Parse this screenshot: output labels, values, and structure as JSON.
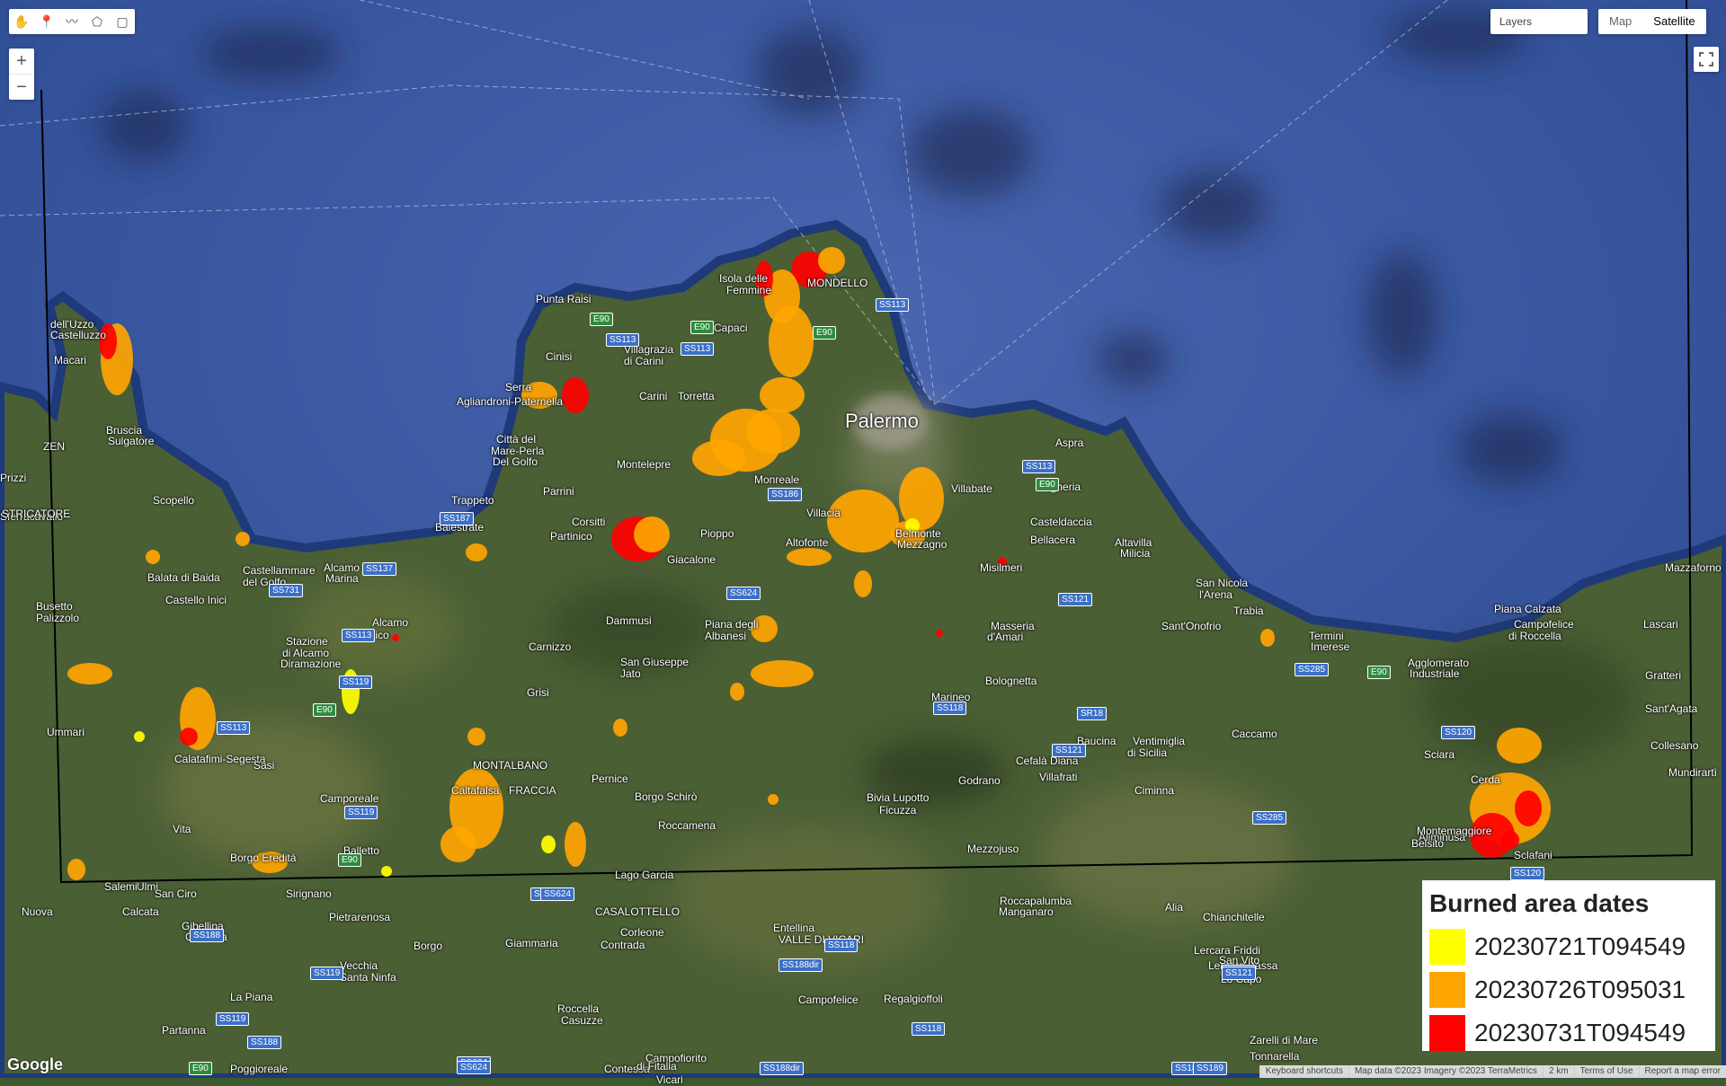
{
  "map": {
    "type": "satellite",
    "sea_color": "#2f4f9a",
    "land_color": "#4a5e33"
  },
  "toolbar": {
    "tools": [
      "pan-hand-icon",
      "marker-icon",
      "line-icon",
      "polygon-icon",
      "rectangle-icon"
    ]
  },
  "zoom": {
    "in": "+",
    "out": "−"
  },
  "layers": {
    "label": "Layers"
  },
  "maptype": {
    "map": "Map",
    "satellite": "Satellite"
  },
  "legend": {
    "title": "Burned area dates",
    "items": [
      {
        "label": "20230721T094549",
        "color": "#ffff00"
      },
      {
        "label": "20230726T095031",
        "color": "#ffa500"
      },
      {
        "label": "20230731T094549",
        "color": "#ff0000"
      }
    ]
  },
  "watermark": "© 2023 Google",
  "places": [
    {
      "name": "Palermo",
      "big": true
    },
    {
      "name": "MONDELLO"
    },
    {
      "name": "Isola delle"
    },
    {
      "name": "Femmine"
    },
    {
      "name": "Punta Raisi"
    },
    {
      "name": "Capaci"
    },
    {
      "name": "Villagrazia"
    },
    {
      "name": "di Carini"
    },
    {
      "name": "Carini"
    },
    {
      "name": "Torretta"
    },
    {
      "name": "Cinisi"
    },
    {
      "name": "Serra"
    },
    {
      "name": "Agliandroni-Paternella"
    },
    {
      "name": "Città del"
    },
    {
      "name": "Mare-Perla"
    },
    {
      "name": "Del Golfo"
    },
    {
      "name": "Montelepre"
    },
    {
      "name": "Trappeto"
    },
    {
      "name": "Parrini"
    },
    {
      "name": "Balestrate"
    },
    {
      "name": "Corsitti"
    },
    {
      "name": "Partinico"
    },
    {
      "name": "Pioppo"
    },
    {
      "name": "Giacalone"
    },
    {
      "name": "Altofonte"
    },
    {
      "name": "Villacia"
    },
    {
      "name": "Monreale"
    },
    {
      "name": "Belmonte"
    },
    {
      "name": "Mezzagno"
    },
    {
      "name": "Misilmeri"
    },
    {
      "name": "Villabate"
    },
    {
      "name": "Bagheria"
    },
    {
      "name": "Aspra"
    },
    {
      "name": "Casteldaccia"
    },
    {
      "name": "Bellacera"
    },
    {
      "name": "Altavilla"
    },
    {
      "name": "Milicia"
    },
    {
      "name": "San Nicola"
    },
    {
      "name": "l'Arena"
    },
    {
      "name": "Trabia"
    },
    {
      "name": "Sant'Onofrio"
    },
    {
      "name": "Termini"
    },
    {
      "name": "Imerese"
    },
    {
      "name": "Agglomerato"
    },
    {
      "name": "Industriale"
    },
    {
      "name": "Piana Calzata"
    },
    {
      "name": "Campofelice"
    },
    {
      "name": "di Roccella"
    },
    {
      "name": "Mazzaforno"
    },
    {
      "name": "Lascari"
    },
    {
      "name": "Gratteri"
    },
    {
      "name": "Sant'Agata"
    },
    {
      "name": "Collesano"
    },
    {
      "name": "Sciara"
    },
    {
      "name": "Cerda"
    },
    {
      "name": "Aliminusa"
    },
    {
      "name": "Montemaggiore"
    },
    {
      "name": "Belsito"
    },
    {
      "name": "Sclafani"
    },
    {
      "name": "Mundirartì"
    },
    {
      "name": "Caccamo"
    },
    {
      "name": "Baucina"
    },
    {
      "name": "Ventimiglia"
    },
    {
      "name": "di Sicilia"
    },
    {
      "name": "Ciminna"
    },
    {
      "name": "Cefalà Diana"
    },
    {
      "name": "Villafrati"
    },
    {
      "name": "Godrano"
    },
    {
      "name": "Marineo"
    },
    {
      "name": "Bolognetta"
    },
    {
      "name": "Masseria"
    },
    {
      "name": "d'Amari"
    },
    {
      "name": "Bivia Lupotto"
    },
    {
      "name": "Ficuzza"
    },
    {
      "name": "Mezzojuso"
    },
    {
      "name": "Piana degli"
    },
    {
      "name": "Albanesi"
    },
    {
      "name": "Dammusi"
    },
    {
      "name": "San Giuseppe"
    },
    {
      "name": "Jato"
    },
    {
      "name": "Carnizzo"
    },
    {
      "name": "Grisi"
    },
    {
      "name": "Fico"
    },
    {
      "name": "Alcamo"
    },
    {
      "name": "Alcamo"
    },
    {
      "name": "Marina"
    },
    {
      "name": "Castellammare"
    },
    {
      "name": "del Golfo"
    },
    {
      "name": "Scopello"
    },
    {
      "name": "Balata di Baida"
    },
    {
      "name": "Castello Inici"
    },
    {
      "name": "Busetto"
    },
    {
      "name": "Palizzolo"
    },
    {
      "name": "Stazione"
    },
    {
      "name": "di Alcamo"
    },
    {
      "name": "Diramazione"
    },
    {
      "name": "Calatafimi-Segesta"
    },
    {
      "name": "Sasi"
    },
    {
      "name": "Ummari"
    },
    {
      "name": "Vita"
    },
    {
      "name": "Borgo Ereditá"
    },
    {
      "name": "Ulmi"
    },
    {
      "name": "Salemi"
    },
    {
      "name": "San Ciro"
    },
    {
      "name": "Calcata"
    },
    {
      "name": "Nuova"
    },
    {
      "name": "Gibellina"
    },
    {
      "name": "Gibellina"
    },
    {
      "name": "Vecchia"
    },
    {
      "name": "Santa Ninfa"
    },
    {
      "name": "La Piana"
    },
    {
      "name": "Partanna"
    },
    {
      "name": "Poggioreale"
    },
    {
      "name": "Borgo"
    },
    {
      "name": "Roccella"
    },
    {
      "name": "Casuzze"
    },
    {
      "name": "Pietrarenosa"
    },
    {
      "name": "Sirignano"
    },
    {
      "name": "Camporeale"
    },
    {
      "name": "FRACCIA"
    },
    {
      "name": "MONTALBANO"
    },
    {
      "name": "Caltafalsa"
    },
    {
      "name": "Balletto"
    },
    {
      "name": "Pernice"
    },
    {
      "name": "Borgo Schirò"
    },
    {
      "name": "Roccamena"
    },
    {
      "name": "Lago Garcia"
    },
    {
      "name": "CASALOTTELLO"
    },
    {
      "name": "Contrada"
    },
    {
      "name": "Giammaria"
    },
    {
      "name": "Corleone"
    },
    {
      "name": "Campofiorito"
    },
    {
      "name": "Contessa"
    },
    {
      "name": "Entellina"
    },
    {
      "name": "VALLE DI VICARI"
    },
    {
      "name": "Campofelice"
    },
    {
      "name": "di Fitalia"
    },
    {
      "name": "Vicari"
    },
    {
      "name": "Regalgioffoli"
    },
    {
      "name": "Roccapalumba"
    },
    {
      "name": "Manganaro"
    },
    {
      "name": "Alia"
    },
    {
      "name": "Chianchitelle"
    },
    {
      "name": "Lercara Friddi"
    },
    {
      "name": "Lercara Bassa"
    },
    {
      "name": "San Vito"
    },
    {
      "name": "Lo Capo"
    },
    {
      "name": "Zarelli di Mare"
    },
    {
      "name": "Tonnarella"
    },
    {
      "name": "dell'Uzzo"
    },
    {
      "name": "Castelluzzo"
    },
    {
      "name": "Macari"
    },
    {
      "name": "Bruscia"
    },
    {
      "name": "Sulgatore"
    },
    {
      "name": "ZEN"
    },
    {
      "name": "Sferracavallo"
    },
    {
      "name": "Prizzi"
    },
    {
      "name": "STRICATORE"
    }
  ],
  "roads": [
    "E90",
    "SS113",
    "E90",
    "SS113",
    "E90",
    "SS113",
    "SS186",
    "SS624",
    "SS113",
    "SS187",
    "SS137",
    "SS731",
    "SS113",
    "SS119",
    "SS113",
    "E90",
    "SS119",
    "E90",
    "SS624",
    "SS118",
    "SS121",
    "SS121",
    "SR18",
    "E90",
    "SS285",
    "E90",
    "SS120",
    "SS285",
    "SS120",
    "SS121",
    "SS624",
    "SS188",
    "SS119",
    "SS119",
    "SS188",
    "SS624",
    "SS118",
    "SS188dir",
    "SS118",
    "SS121",
    "SS188",
    "SS189",
    "SS624",
    "SS188dir",
    "E90"
  ],
  "footer": {
    "shortcuts": "Keyboard shortcuts",
    "attribution": "Map data ©2023 Imagery ©2023 TerraMetrics",
    "scale": "2 km",
    "terms": "Terms of Use",
    "report": "Report a map error"
  },
  "google_logo": "Google"
}
